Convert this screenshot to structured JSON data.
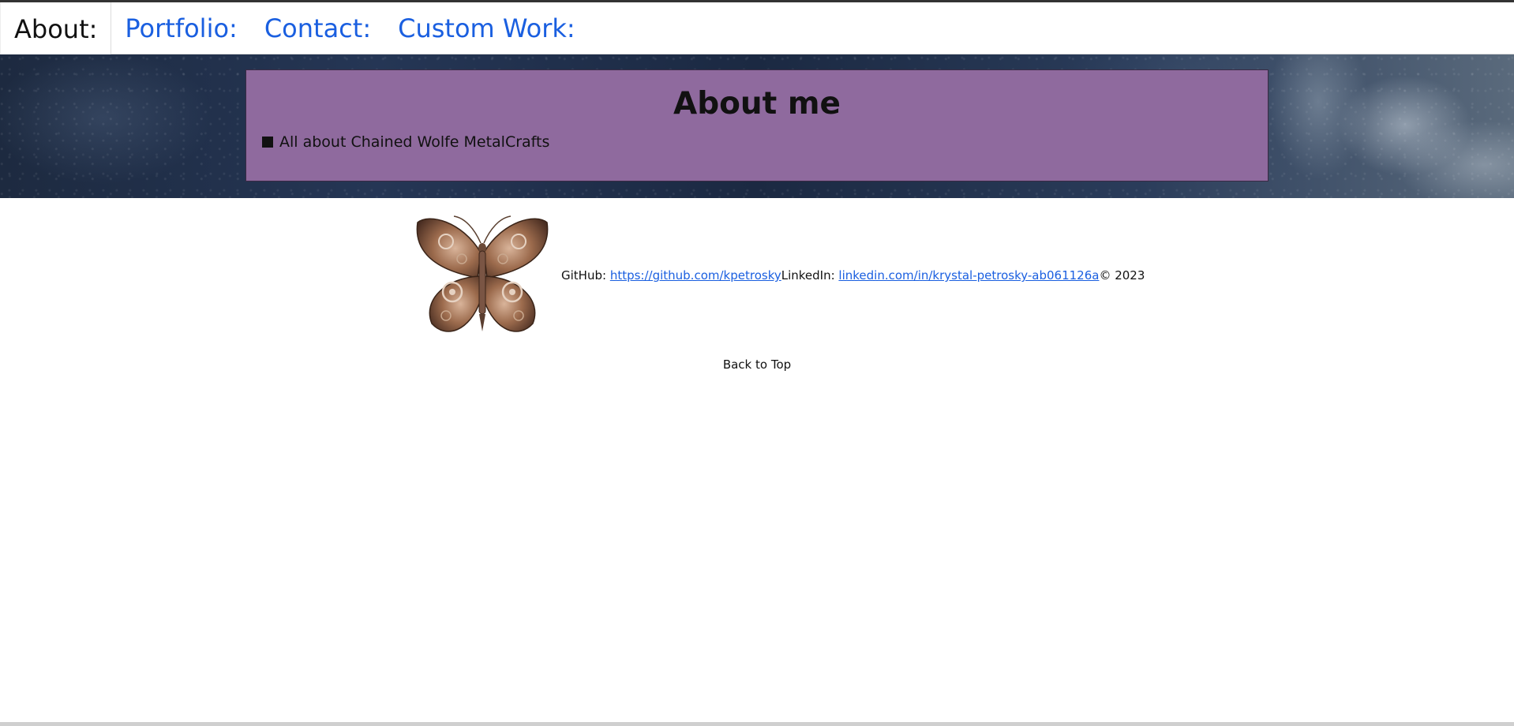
{
  "nav": {
    "tabs": [
      {
        "label": "About:"
      },
      {
        "label": "Portfolio:"
      },
      {
        "label": "Contact:"
      },
      {
        "label": "Custom Work:"
      }
    ]
  },
  "about": {
    "title": "About me",
    "items": [
      "All about Chained Wolfe MetalCrafts"
    ]
  },
  "footer": {
    "github_label": "GitHub: ",
    "github_link": "https://github.com/kpetrosky",
    "linkedin_label": "LinkedIn: ",
    "linkedin_link": "linkedin.com/in/krystal-petrosky-ab061126a",
    "copyright": "© 2023",
    "back_to_top": "Back to Top"
  },
  "colors": {
    "nav_link": "#1a5fe0",
    "about_box": "#8f6a9e",
    "hero_bg": "#1d2a40"
  },
  "icons": {
    "logo": "steampunk-butterfly"
  }
}
